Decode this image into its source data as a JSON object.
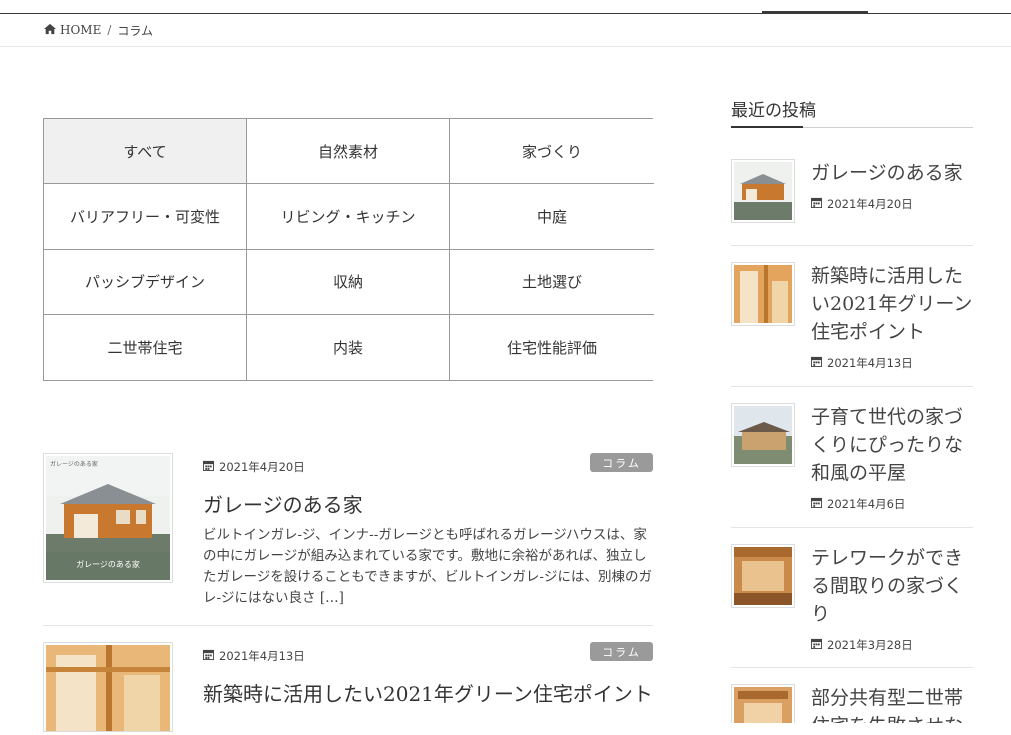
{
  "breadcrumb": {
    "home": "HOME",
    "separator": "/",
    "current": "コラム"
  },
  "categories": [
    "すべて",
    "自然素材",
    "家づくり",
    "バリアフリー・可変性",
    "リビング・キッチン",
    "中庭",
    "パッシブデザイン",
    "収納",
    "土地選び",
    "二世帯住宅",
    "内装",
    "住宅性能評価"
  ],
  "posts": [
    {
      "date": "2021年4月20日",
      "category": "コラム",
      "title": "ガレージのある家",
      "excerpt": "ビルトインガレ‐ジ、インナ‐‐ガレージとも呼ばれるガレージハウスは、家の中にガレージが組み込まれている家です。敷地に余裕があれば、独立したガレージを設けることもできますが、ビルトインガレ‐ジには、別棟のガレ‐ジにはない良さ […]",
      "thumb_caption": "ガレージのある家",
      "thumb_top_text": "ガレージのある家"
    },
    {
      "date": "2021年4月13日",
      "category": "コラム",
      "title": "新築時に活用したい2021年グリーン住宅ポイント",
      "excerpt": "",
      "thumb_caption": "",
      "thumb_top_text": ""
    }
  ],
  "sidebar": {
    "title": "最近の投稿",
    "items": [
      {
        "title": "ガレージのある家",
        "date": "2021年4月20日"
      },
      {
        "title": "新築時に活用したい2021年グリーン住宅ポイント",
        "date": "2021年4月13日"
      },
      {
        "title": "子育て世代の家づくりにぴったりな和風の平屋",
        "date": "2021年4月6日"
      },
      {
        "title": "テレワークができる間取りの家づくり",
        "date": "2021年3月28日"
      },
      {
        "title": "部分共有型二世帯住宅を失敗させない",
        "date": ""
      }
    ]
  },
  "colors": {
    "badge": "#9a9a9a",
    "active_cell": "#f0f0f0",
    "text": "#333333"
  }
}
